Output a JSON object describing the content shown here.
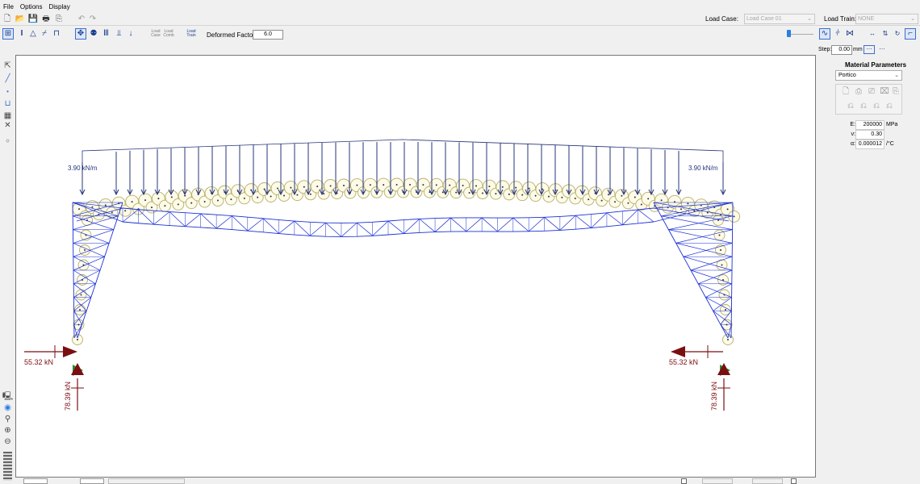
{
  "menu": [
    "File",
    "Options",
    "Display"
  ],
  "toolbar": {
    "load_case_label": "Load Case:",
    "load_case_value": "Load Case 01",
    "load_train_label": "Load Train:",
    "load_train_value": "NONE",
    "deformed_factor_label": "Deformed Factor:",
    "deformed_factor_value": "6.0",
    "load_case_btn": [
      "Load",
      "Case"
    ],
    "load_comb_btn": [
      "Load",
      "Comb"
    ],
    "load_train_btn": [
      "Load",
      "Train"
    ]
  },
  "right_panel": {
    "step_label": "Step:",
    "step_value": "0.00",
    "step_unit": "mm",
    "title": "Material Parameters",
    "material": "Portico",
    "E_label": "E:",
    "E_value": "200000",
    "E_unit": "MPa",
    "nu_label": "ν:",
    "nu_value": "0.30",
    "alpha_label": "α:",
    "alpha_value": "0.000012",
    "alpha_unit": "/°C"
  },
  "diagram": {
    "load_left": "3.90 kN/m",
    "load_right": "3.90 kN/m",
    "reaction_h_left": "55.32 kN",
    "reaction_h_right": "55.32 kN",
    "reaction_v_left": "78.39 kN",
    "reaction_v_right": "78.39 kN"
  },
  "colors": {
    "structure": "#1a2fd6",
    "load_arrows": "#26357a",
    "moment_fill": "#fdfbe8",
    "moment_stroke": "#b6ae6a",
    "reactions": "#7a0f12",
    "supports": "#2e8b2e"
  }
}
